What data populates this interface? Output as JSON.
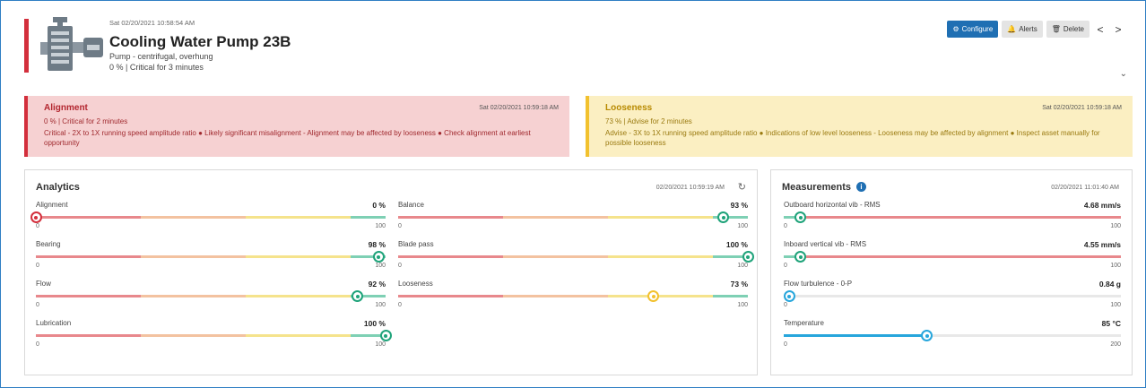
{
  "asset": {
    "timestamp": "Sat 02/20/2021 10:58:54 AM",
    "name": "Cooling Water Pump 23B",
    "type": "Pump - centrifugal, overhung",
    "status": "0 % | Critical for 3 minutes",
    "image_icon": "pump-icon"
  },
  "toolbar": {
    "configure_label": "Configure",
    "alerts_label": "Alerts",
    "delete_label": "Delete",
    "prev_label": "<",
    "next_label": ">"
  },
  "alerts": [
    {
      "title": "Alignment",
      "time": "Sat 02/20/2021 10:59:18 AM",
      "summary": "0 % | Critical for 2 minutes",
      "detail": "Critical - 2X to 1X running speed amplitude ratio ● Likely significant misalignment - Alignment may be affected by looseness ● Check alignment at earliest opportunity",
      "color": "#d32f3c"
    },
    {
      "title": "Looseness",
      "time": "Sat 02/20/2021 10:59:18 AM",
      "summary": "73 % | Advise for 2 minutes",
      "detail": "Advise - 3X to 1X running speed amplitude ratio ● Indications of low level looseness - Looseness may be affected by alignment ● Inspect asset manually for possible looseness",
      "color": "#f2c12e"
    }
  ],
  "analytics": {
    "title": "Analytics",
    "time": "02/20/2021 10:59:19 AM",
    "gauges": [
      {
        "label": "Alignment",
        "value_text": "0 %",
        "value": 0,
        "min": "0",
        "max": "100",
        "marker_color": "#d32f3c"
      },
      {
        "label": "Bearing",
        "value_text": "98 %",
        "value": 98,
        "min": "0",
        "max": "100",
        "marker_color": "#1fa37a"
      },
      {
        "label": "Flow",
        "value_text": "92 %",
        "value": 92,
        "min": "0",
        "max": "100",
        "marker_color": "#1fa37a"
      },
      {
        "label": "Lubrication",
        "value_text": "100 %",
        "value": 100,
        "min": "0",
        "max": "100",
        "marker_color": "#1fa37a"
      },
      {
        "label": "Balance",
        "value_text": "93 %",
        "value": 93,
        "min": "0",
        "max": "100",
        "marker_color": "#1fa37a"
      },
      {
        "label": "Blade pass",
        "value_text": "100 %",
        "value": 100,
        "min": "0",
        "max": "100",
        "marker_color": "#1fa37a"
      },
      {
        "label": "Looseness",
        "value_text": "73 %",
        "value": 73,
        "min": "0",
        "max": "100",
        "marker_color": "#f2c12e"
      }
    ]
  },
  "measurements": {
    "title": "Measurements",
    "time": "02/20/2021 11:01:40 AM",
    "gauges": [
      {
        "label": "Outboard horizontal vib - RMS",
        "value_text": "4.68 mm/s",
        "fraction": 0.05,
        "min": "0",
        "max": "100",
        "style": "green-red",
        "marker_color": "#1fa37a"
      },
      {
        "label": "Inboard vertical vib - RMS",
        "value_text": "4.55 mm/s",
        "fraction": 0.05,
        "min": "0",
        "max": "100",
        "style": "green-red",
        "marker_color": "#1fa37a"
      },
      {
        "label": "Flow turbulence - 0-P",
        "value_text": "0.84 g",
        "fraction": 0.0,
        "min": "0",
        "max": "100",
        "style": "blue",
        "marker_color": "#27a6dc"
      },
      {
        "label": "Temperature",
        "value_text": "85 °C",
        "fraction": 0.425,
        "min": "0",
        "max": "200",
        "style": "blue",
        "marker_color": "#27a6dc"
      }
    ]
  }
}
